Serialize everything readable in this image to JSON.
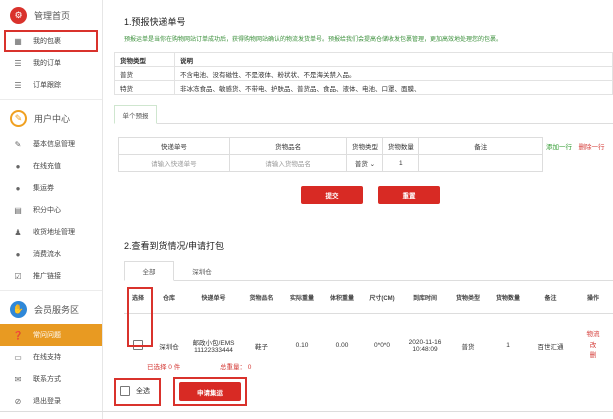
{
  "sidebar": {
    "home_label": "管理首页",
    "package_label": "我的包裹",
    "orders_label": "我的订单",
    "tracking_label": "订单跟踪",
    "user_center_label": "用户中心",
    "basic_info_label": "基本信息管理",
    "recharge_label": "在线充值",
    "coupon_label": "集运券",
    "points_label": "积分中心",
    "address_label": "收货地址管理",
    "funds_label": "消费流水",
    "promo_label": "推广链接",
    "member_area_label": "会员服务区",
    "faq_label": "常问问题",
    "support_label": "在线支持",
    "contact_label": "联系方式",
    "logout_label": "退出登录",
    "colors": {
      "home_icon": "#d9322c",
      "user_center_icon": "#f0a020",
      "member_area_icon": "#2f88d8",
      "active_bg": "#e89a22"
    }
  },
  "section1": {
    "title": "1.预报快递单号",
    "notice": "预报运单是当你在购物网站订单成功后，获得购物网站确认的物流发货单号。预报给我们会提高仓储收发包裹管理，更加高效地处理您的包裹。",
    "info_header": [
      "货物类型",
      "说明"
    ],
    "info_rows": [
      [
        "普货",
        "不含电池、没有磁性、不是液体、粉状状、不是海关禁入品。"
      ],
      [
        "特货",
        "非冰冻食品、敏感货、不带电、护肤品、普货品、食品、液体、电池、口罩、面膜、"
      ]
    ],
    "tab_label": "单个预报",
    "form_headers": [
      "快递单号",
      "货物品名",
      "货物类型",
      "货物数量",
      "备注"
    ],
    "tracking_placeholder": "请输入快递单号",
    "goods_placeholder": "请输入货物品名",
    "goods_type_value": "普货",
    "quantity_value": "1",
    "add_row_label": "添加一行",
    "delete_row_label": "删除一行",
    "submit_label": "提交",
    "reset_label": "重置"
  },
  "section2": {
    "title": "2.查看到货情况/申请打包",
    "tab_all": "全部",
    "tab_warehouse": "深圳仓",
    "headers": [
      "选择",
      "仓库",
      "快递单号",
      "货物品名",
      "实际重量",
      "体积重量",
      "尺寸(CM)",
      "到库时间",
      "货物类型",
      "货物数量",
      "备注",
      "操作"
    ],
    "row": {
      "warehouse": "深圳仓",
      "tracking_line1": "邮政小包/EMS",
      "tracking_line2": "11122333444",
      "goods": "鞋子",
      "actual_weight": "0.10",
      "volume_weight": "0.00",
      "size": "0*0*0",
      "arrival_date": "2020-11-16",
      "arrival_time": "10:48:09",
      "goods_type": "普货",
      "quantity": "1",
      "remark": "百世汇通",
      "action_line1": "物流",
      "action_line2": "改",
      "action_line3": "删"
    },
    "selected_text": "已选择 0 件",
    "total_weight_text": "总重量： 0",
    "select_all_label": "全选",
    "apply_button": "申请集运"
  }
}
